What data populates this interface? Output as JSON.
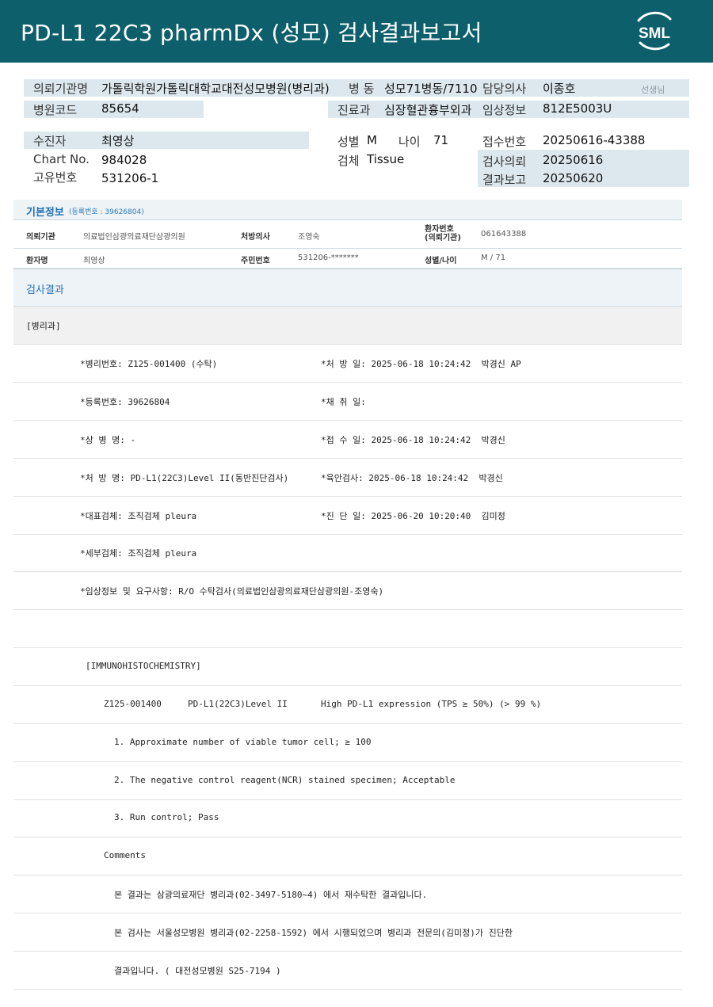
{
  "header": {
    "title": "PD-L1 22C3 pharmDx (성모) 검사결과보고서",
    "logo_text": "SML",
    "color": "#0d5f6b"
  },
  "info": {
    "requesting_institution": {
      "label": "의뢰기관명",
      "value": "가톨릭학원가톨릭대학교대전성모병원(병리과)"
    },
    "hospital_code": {
      "label": "병원코드",
      "value": "85654"
    },
    "ward": {
      "label": "병 동",
      "value": "성모71병동/7110"
    },
    "department": {
      "label": "진료과",
      "value": "심장혈관흉부외과"
    },
    "doctor": {
      "label": "담당의사",
      "value": "이종호",
      "suffix": "선생님"
    },
    "clinical_info": {
      "label": "임상정보",
      "value": "812E5003U"
    },
    "patient": {
      "label": "수진자",
      "value": "최영상"
    },
    "chart_no": {
      "label": "Chart No.",
      "value": "984028"
    },
    "unique_no": {
      "label": "고유번호",
      "value": "531206-1"
    },
    "sex": {
      "label": "성별",
      "value": "M"
    },
    "age": {
      "label": "나이",
      "value": "71"
    },
    "specimen": {
      "label": "검체",
      "value": "Tissue"
    },
    "receipt_no": {
      "label": "접수번호",
      "value": "20250616-43388"
    },
    "request_date": {
      "label": "검사의뢰",
      "value": "20250616"
    },
    "report_date": {
      "label": "결과보고",
      "value": "20250620"
    }
  },
  "basic": {
    "title": "기본정보",
    "reg_note": "(등록번호 : 39626804)",
    "row1": {
      "inst_label": "의뢰기관",
      "inst_value": "의료법인삼광의료재단삼광의원",
      "doc_label": "처방의사",
      "doc_value": "조영숙",
      "pno_label_1": "환자번호",
      "pno_label_2": "(의뢰기관)",
      "pno_value": "061643388"
    },
    "row2": {
      "name_label": "환자명",
      "name_value": "최영상",
      "rrn_label": "주민번호",
      "rrn_value": "531206-*******",
      "sexage_label": "성별/나이",
      "sexage_value": "M / 71"
    }
  },
  "results": {
    "title": "검사결과",
    "dept": "[병리과]",
    "lines": [
      {
        "left": "*병리번호: Z125-001400 (수탁)",
        "right": "*처 방 일: 2025-06-18 10:24:42  박경신 AP"
      },
      {
        "left": "*등록번호: 39626804",
        "right": "*채 취 일:"
      },
      {
        "left": "*상 병 명: -",
        "right": "*접 수 일: 2025-06-18 10:24:42  박경신"
      },
      {
        "left": "*처 방 명: PD-L1(22C3)Level II(동반진단검사)",
        "right": "*육안검사: 2025-06-18 10:24:42  박경신"
      },
      {
        "left": "*대표검체: 조직검체 pleura",
        "right": "*진 단 일: 2025-06-20 10:20:40  김미정"
      },
      {
        "left": "*세부검체: 조직검체 pleura",
        "right": ""
      },
      {
        "left": "*임상정보 및 요구사항: R/O 수탁검사(의료법인삼광의료재단삼광의원-조영숙)",
        "right": ""
      }
    ],
    "ihc_header": "[IMMUNOHISTOCHEMISTRY]",
    "ihc_id": "Z125-001400",
    "ihc_test": "PD-L1(22C3)Level II",
    "ihc_result": "High PD-L1 expression (TPS ≥ 50%) (> 99 %)",
    "item1": "1. Approximate number of viable tumor cell; ≥ 100",
    "item2": "2. The negative control reagent(NCR) stained specimen; Acceptable",
    "item3": "3. Run control; Pass",
    "comments_label": "Comments",
    "comment1": "본 결과는 삼광의료재단 병리과(02-3497-5180~4) 에서 재수탁한 결과입니다.",
    "comment2": "본 검사는 서울성모병원 병리과(02-2258-1592) 에서 시행되었으며 병리과 전문의(김미정)가 진단한",
    "comment3": "결과입니다. ( 대전성모병원 S25-7194 )"
  }
}
